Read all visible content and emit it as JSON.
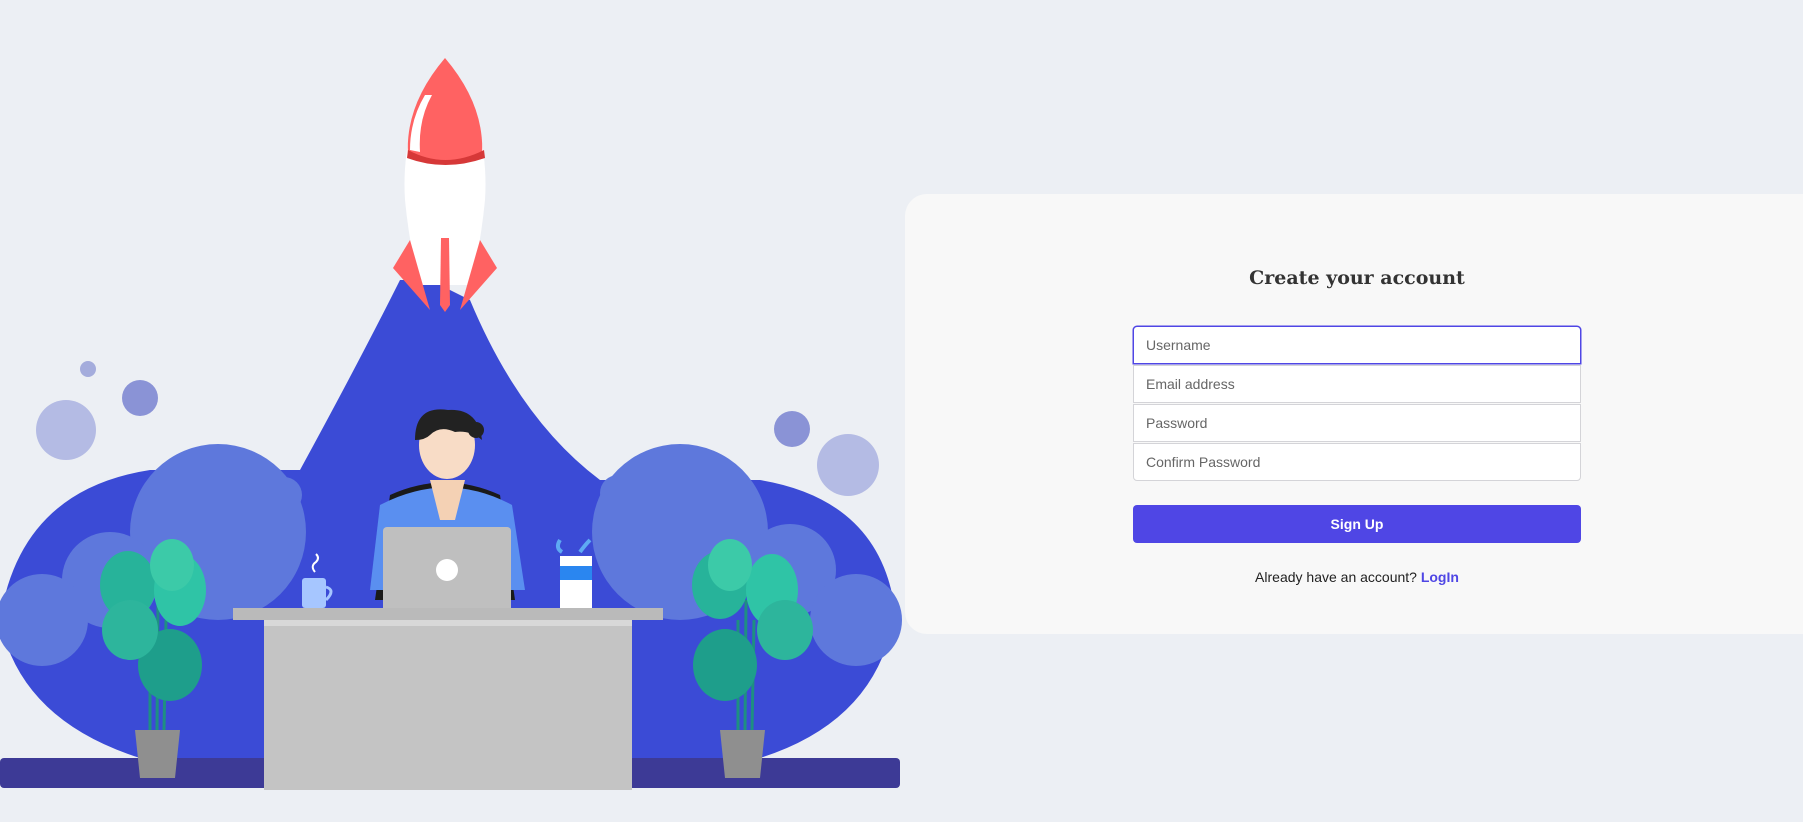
{
  "form": {
    "title": "Create your account",
    "username_placeholder": "Username",
    "email_placeholder": "Email address",
    "password_placeholder": "Password",
    "confirm_placeholder": "Confirm Password",
    "submit_label": "Sign Up",
    "signin_prompt": "Already have an account?",
    "signin_link": "LogIn"
  },
  "colors": {
    "accent": "#4f46e5",
    "page_bg": "#eceff4",
    "card_bg": "#f8f8f8",
    "illustration_blue": "#3b4bd6"
  },
  "illustration": {
    "subject": "person at desk with laptop, rocket launching, plants, coffee mug, pencil cup"
  }
}
